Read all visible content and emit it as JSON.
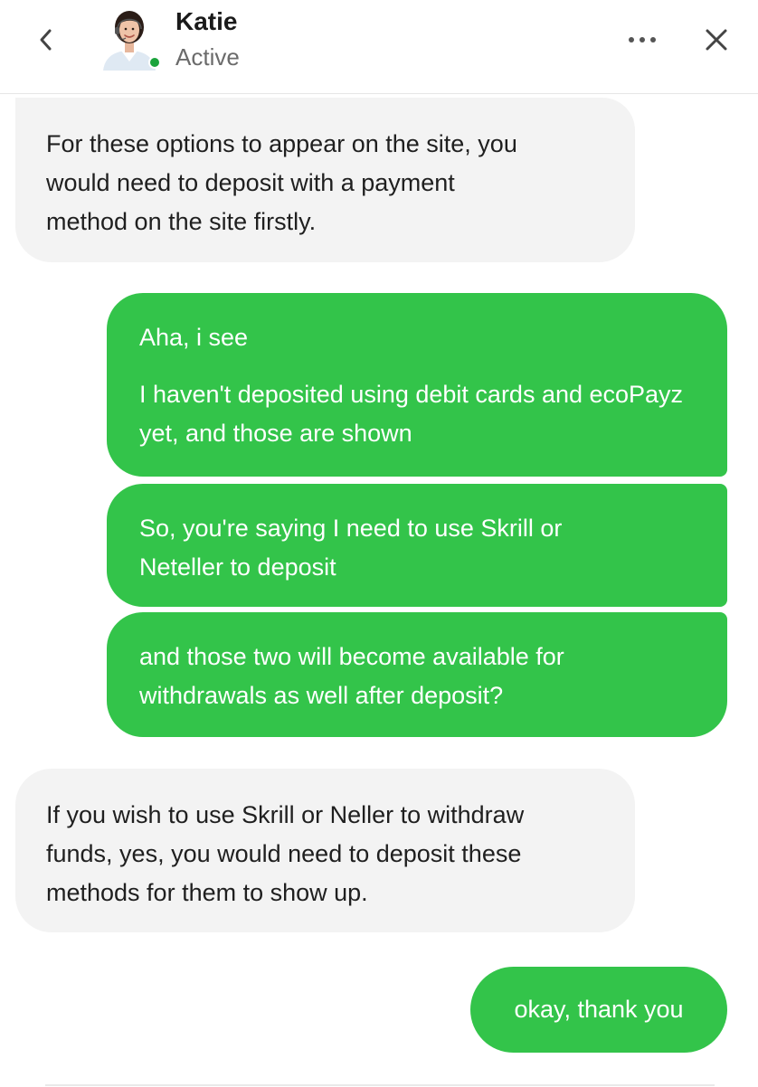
{
  "header": {
    "agent_name": "Katie",
    "agent_status": "Active",
    "icons": {
      "back": "chevron-left-icon",
      "more": "more-horizontal-icon",
      "close": "close-icon"
    },
    "status_color": "#1aa33c"
  },
  "messages": [
    {
      "sender": "agent",
      "lines": [
        "For these options to appear on the site, you",
        "would need to deposit with a payment",
        "method on the site firstly."
      ]
    },
    {
      "sender": "user",
      "paragraphs": [
        "Aha, i see",
        "I haven't deposited using debit cards and ecoPayz yet, and those are shown"
      ]
    },
    {
      "sender": "user",
      "lines": [
        "So, you're saying I need to use Skrill or",
        "Neteller to deposit"
      ]
    },
    {
      "sender": "user",
      "lines": [
        "and those two will become available for",
        "withdrawals as well after deposit?"
      ]
    },
    {
      "sender": "agent",
      "lines": [
        "If you wish to use Skrill or Neller to withdraw",
        "funds, yes, you would need to deposit these",
        "methods for them to show up."
      ]
    },
    {
      "sender": "user",
      "lines": [
        "okay, thank you"
      ]
    }
  ],
  "colors": {
    "user_bubble": "#33c44a",
    "agent_bubble": "#f3f3f3"
  }
}
